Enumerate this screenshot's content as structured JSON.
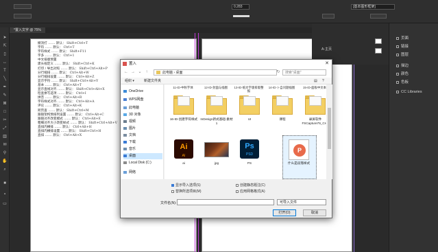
{
  "topbar": {
    "stroke_weight": "0.283",
    "frame_style": "[基本图形框架]"
  },
  "tab": {
    "title": "*置入文字 @ 75%"
  },
  "right_panel": {
    "items": [
      "页面",
      "链接",
      "图层",
      "描边",
      "颜色",
      "色板",
      "CC Libraries"
    ],
    "a_master": "A-主页"
  },
  "document": {
    "lines": [
      "撤消打 ....... 默认：  Shift+Ctrl+T",
      "字符 ....... 默认：  Ctrl+T",
      "字符样式 ....... 默认：  Shift+F11",
      "字多 ....... 默认：  Ctrl+1",
      "中文排版预置",
      "建头规定义 ....... 默认：  Shift+Ctrl+K",
      "打印 / 导出对照 ....... 默认：  Shift+Ctrl+Alt+P",
      "分行缩排 ....... 默认：  Ctrl+Alt+W",
      "分行缩排设置 ....... 默认：  Ctrl+Alt+Z",
      "显示字符 ....... 默认：  Shift+Ctrl+Alt+Y",
      "基本 ....... 默认：  Ctrl+Alt+T",
      "显示直线对齐 ....... 默认：  Shift+Ctrl+Alt+X",
      "检查拼写选项 ....... 默认：  Ctrl+I",
      "拼音 ....... 默认：  Ctrl+Alt+R",
      "字符样式对齐 ....... 默认：  Ctrl+Alt+A",
      "评论 ....... 默认：  Ctrl+Alt+K",
      "跨页查 ....... 默认：  Shift+Ctrl+M",
      "跟随架构预排列设置 ....... 默认：  Ctrl+Alt+C",
      "跟随对齐改变模式 ....... 默认：  Ctrl+Alt+E",
      "粗细对齐大小改变样式 ....... 默认：  Shift+Ctrl+Alt+V",
      "直排内横排 ....... 默认：  Ctrl+Alt+H",
      "直排内横排设置 ....... 默认：  Shift+Ctrl+H",
      "直排 ....... 默认：  Ctrl+Alt+X"
    ]
  },
  "dialog": {
    "title": "置入",
    "address": [
      "此电脑",
      "桌面"
    ],
    "search_placeholder": "搜索\"桌面\"",
    "toolbar": {
      "organize": "组织 ▾",
      "new_folder": "新建文件夹"
    },
    "sidebar": [
      {
        "label": "OneDrive",
        "icon": "cloud-icon",
        "color": "#3b8ad8"
      },
      {
        "label": "WPS网盘",
        "icon": "cloud-icon",
        "color": "#4a7fd4"
      },
      {
        "label": "此电脑",
        "icon": "computer-icon",
        "color": "#6a9fd8"
      },
      {
        "label": "3D 对象",
        "icon": "cube-icon",
        "color": "#5aa9e6"
      },
      {
        "label": "视频",
        "icon": "video-icon",
        "color": "#6b7d8e"
      },
      {
        "label": "图片",
        "icon": "picture-icon",
        "color": "#6b8fb0"
      },
      {
        "label": "文档",
        "icon": "document-icon",
        "color": "#7b8da0"
      },
      {
        "label": "下载",
        "icon": "download-icon",
        "color": "#3a7bd5"
      },
      {
        "label": "音乐",
        "icon": "music-icon",
        "color": "#6f8fb0"
      },
      {
        "label": "桌面",
        "icon": "desktop-icon",
        "color": "#3a7bd5"
      },
      {
        "label": "Local Disk (C:)",
        "icon": "disk-icon",
        "color": "#8a8a8a"
      },
      {
        "label": "网络",
        "icon": "network-icon",
        "color": "#6a9fd8"
      }
    ],
    "top_labels": [
      "11-ID-中秋字体",
      "12-ID-封面与插图",
      "13-ID-纸文字版排版整报",
      "14-ID-卜自问题插图",
      "15-ID-面板中文本",
      ""
    ],
    "files": [
      {
        "label": "",
        "kind": "folder"
      },
      {
        "label": "",
        "kind": "folder"
      },
      {
        "label": "UI",
        "kind": "folder"
      },
      {
        "label": "课程",
        "kind": "folder"
      },
      {
        "label": "录屏软件FSCapture79_CH5",
        "kind": "folder"
      },
      {
        "label": "16-ID-创建字符样式",
        "kind": "folder"
      },
      {
        "label": "InDesign新式基础-素材1",
        "kind": "folder"
      },
      {
        "label": "ai",
        "kind": "ai"
      },
      {
        "label": "jpg",
        "kind": "jpg"
      },
      {
        "label": "PS",
        "kind": "ps"
      },
      {
        "label": "什么是段落样式",
        "kind": "pptx"
      }
    ],
    "options": {
      "show_import": "显示导入选项(S)",
      "replace_selected": "替换所选项目(M)",
      "create_static": "创建静态题注(C)",
      "apply_grid": "应用网格格式(A)"
    },
    "filename_label": "文件名(N):",
    "filetype": "可导入文件",
    "open_btn": "打开(O)",
    "cancel_btn": "取消"
  }
}
